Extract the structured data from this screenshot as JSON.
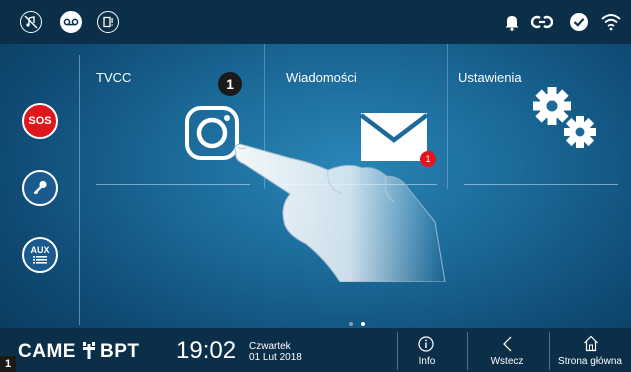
{
  "topbar": {
    "left_icons": [
      "mute-icon",
      "voicemail-icon",
      "door-status-icon"
    ],
    "right_icons": [
      "bell-icon",
      "link-icon",
      "check-icon",
      "wifi-icon"
    ]
  },
  "sidebar": {
    "sos_label": "SOS",
    "key_icon": "key-icon",
    "aux_label": "AUX"
  },
  "tiles": [
    {
      "title": "TVCC",
      "icon": "camera-icon"
    },
    {
      "title": "Wiadomości",
      "icon": "envelope-icon",
      "badge": "1"
    },
    {
      "title": "Ustawienia",
      "icon": "gears-icon"
    }
  ],
  "marker_label": "1",
  "pager": {
    "pages": 2,
    "active": 2
  },
  "bottombar": {
    "brand_left": "CAME",
    "brand_right": "BPT",
    "time": "19:02",
    "day": "Czwartek",
    "date": "01 Lut 2018",
    "info_label": "Info",
    "back_label": "Wstecz",
    "home_label": "Strona główna"
  },
  "corner_label": "1",
  "colors": {
    "bar": "#0b2f49",
    "accent_red": "#e0161d",
    "background": "#1b6a99"
  }
}
